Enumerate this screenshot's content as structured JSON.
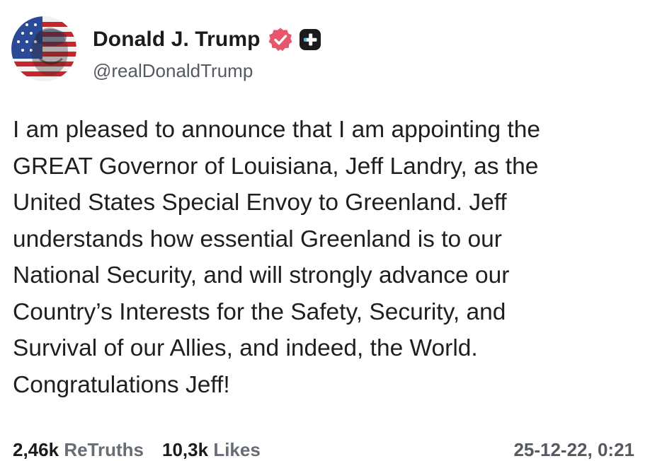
{
  "author": {
    "display_name": "Donald J. Trump",
    "handle": "@realDonaldTrump",
    "verified_icon": "verified-badge-icon",
    "plus_icon": "plus-badge-icon"
  },
  "post": {
    "text": "I am pleased to announce that I am appointing the\nGREAT Governor of Louisiana, Jeff Landry, as the\nUnited States Special Envoy to Greenland. Jeff\nunderstands how essential Greenland is to our\nNational Security, and will strongly advance our\nCountry’s Interests for the Safety, Security, and\nSurvival of our Allies, and indeed, the World.\nCongratulations Jeff!"
  },
  "stats": {
    "retruths_count": "2,46k",
    "retruths_label": "ReTruths",
    "likes_count": "10,3k",
    "likes_label": "Likes",
    "timestamp": "25-12-22, 0:21"
  },
  "colors": {
    "verified": "#e8566b",
    "plus_badge": "#1b1b1b",
    "text": "#1f1f1f",
    "muted": "#555a61"
  }
}
